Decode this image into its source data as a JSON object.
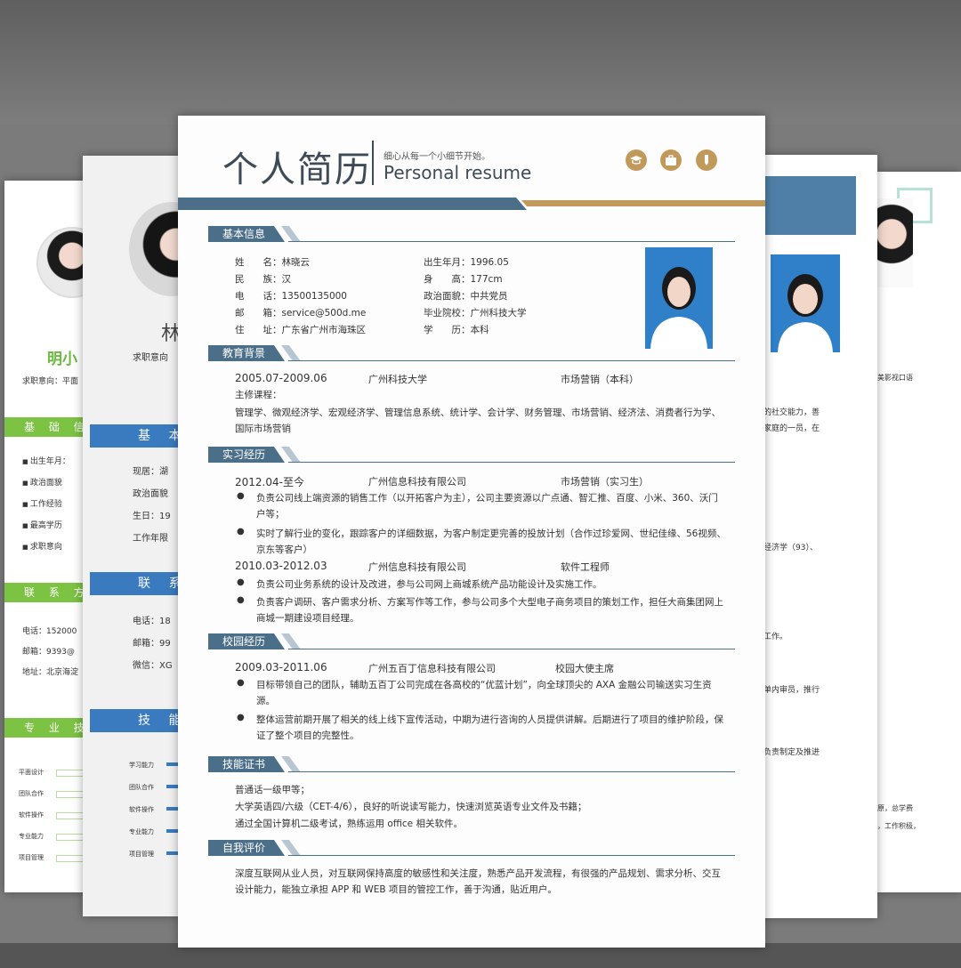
{
  "main": {
    "title": "个人简历",
    "slogan": "细心从每一个小细节开始。",
    "subtitle": "Personal resume",
    "header_icons": [
      "graduation-cap-icon",
      "briefcase-icon",
      "pen-icon"
    ],
    "sections": {
      "basic": "基本信息",
      "education": "教育背景",
      "internship": "实习经历",
      "campus": "校园经历",
      "skills": "技能证书",
      "evaluation": "自我评价"
    },
    "basic_info": {
      "name": "姓　　名：林晓云",
      "ethnicity": "民　　族：汉",
      "phone": "电　　话：13500135000",
      "email": "邮　　箱：service@500d.me",
      "address": "住　　址：广东省广州市海珠区",
      "birth": "出生年月：1996.05",
      "height": "身　　高：177cm",
      "politics": "政治面貌：中共党员",
      "school": "毕业院校：广州科技大学",
      "degree": "学　　历：本科"
    },
    "education": {
      "period": "2005.07-2009.06",
      "school": "广州科技大学",
      "major": "市场营销（本科）",
      "courses_label": "主修课程：",
      "courses": "管理学、微观经济学、宏观经济学、管理信息系统、统计学、会计学、财务管理、市场营销、经济法、消费者行为学、国际市场营销"
    },
    "internship": [
      {
        "period": "2012.04-至今",
        "company": "广州信息科技有限公司",
        "role": "市场营销（实习生）",
        "bullets": [
          "负责公司线上端资源的销售工作（以开拓客户为主），公司主要资源以广点通、智汇推、百度、小米、360、沃门户等；",
          "实时了解行业的变化，跟踪客户的详细数据，为客户制定更完善的投放计划（合作过珍爱网、世纪佳缘、56视频、京东等客户）"
        ]
      },
      {
        "period": "2010.03-2012.03",
        "company": "广州信息科技有限公司",
        "role": "软件工程师",
        "bullets": [
          "负责公司业务系统的设计及改进，参与公司网上商城系统产品功能设计及实施工作。",
          "负责客户调研、客户需求分析、方案写作等工作，参与公司多个大型电子商务项目的策划工作，担任大商集团网上商城一期建设项目经理。"
        ]
      }
    ],
    "campus": {
      "period": "2009.03-2011.06",
      "company": "广州五百丁信息科技有限公司",
      "role": "校园大使主席",
      "bullets": [
        "目标带领自己的团队，辅助五百丁公司完成在各高校的“优蓝计划”，向全球顶尖的 AXA 金融公司输送实习生资源。",
        "整体运营前期开展了相关的线上线下宣传活动，中期为进行咨询的人员提供讲解。后期进行了项目的维护阶段，保证了整个项目的完整性。"
      ]
    },
    "skills": [
      "普通话一级甲等；",
      "大学英语四/六级（CET-4/6），良好的听说读写能力，快速浏览英语专业文件及书籍；",
      "通过全国计算机二级考试，熟练运用 office 相关软件。"
    ],
    "evaluation": "深度互联网从业人员，对互联网保持高度的敏感性和关注度，熟悉产品开发流程，有很强的产品规划、需求分析、交互设计能力，能独立承担 APP 和 WEB 项目的管控工作，善于沟通，贴近用户。"
  },
  "page1": {
    "name": "明小",
    "intent": "求职意向：平面",
    "sec_basic": "基 础 信",
    "items": [
      "出生年月：",
      "政治面貌",
      "工作经验",
      "最高学历",
      "求职意向"
    ],
    "sec_contact": "联 系 方",
    "contact": [
      "电话：152000",
      "邮箱：9393@",
      "地址：北京海淀"
    ],
    "sec_skill": "专 业 技",
    "skills": [
      "平面设计",
      "团队合作",
      "软件操作",
      "专业能力",
      "项目管理"
    ]
  },
  "page2": {
    "name": "林",
    "intent": "求职意向",
    "sec_basic": "基 本",
    "rows1": [
      "现居：湖",
      "政治面貌",
      "生日：19",
      "工作年限"
    ],
    "sec_contact": "联 系",
    "rows2": [
      "电话：18",
      "邮箱：99",
      "微信：XG"
    ],
    "sec_skill": "技 能",
    "skills": [
      "学习能力",
      "团队合作",
      "软件操作",
      "专业能力",
      "项目管理"
    ]
  },
  "page4": {
    "texts": [
      "的社交能力，善",
      "家庭的一员，在",
      "经济学（93）、",
      "工作。",
      "单内审员，推行",
      "负责制定及推进"
    ]
  },
  "page5": {
    "texts": [
      "美影视口语",
      "原，总学费",
      "，工作积极，"
    ]
  },
  "colors": {
    "primary": "#4c6f89",
    "accent": "#c19a5b",
    "green": "#7cc243",
    "blue": "#3a7abf"
  }
}
